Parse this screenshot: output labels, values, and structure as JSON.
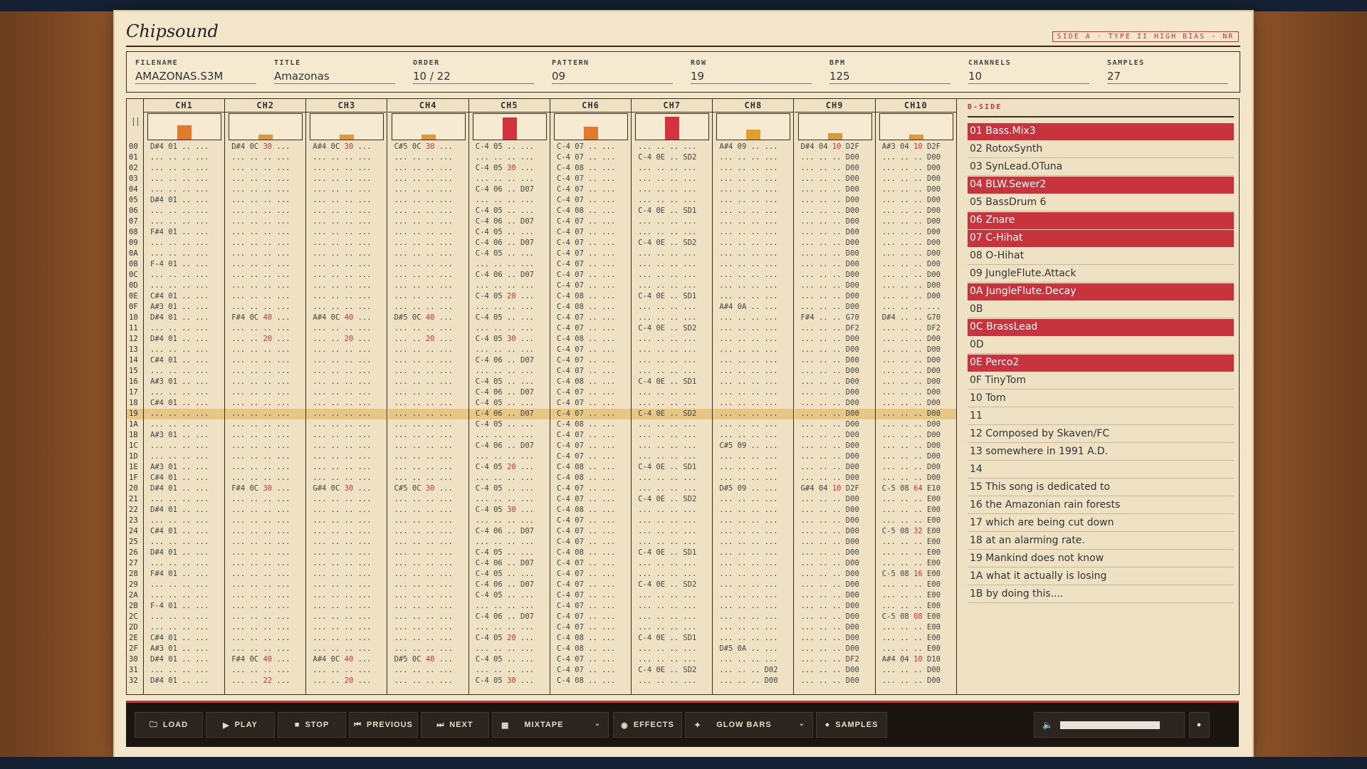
{
  "app": {
    "title": "Chipsound",
    "tape_label": "SIDE A · TYPE II HIGH BIAS · NR"
  },
  "meta": [
    {
      "label": "FILENAME",
      "value": "AMAZONAS.S3M"
    },
    {
      "label": "TITLE",
      "value": "Amazonas"
    },
    {
      "label": "ORDER",
      "value": "10 / 22"
    },
    {
      "label": "PATTERN",
      "value": "09"
    },
    {
      "label": "ROW",
      "value": "19"
    },
    {
      "label": "BPM",
      "value": "125"
    },
    {
      "label": "CHANNELS",
      "value": "10"
    },
    {
      "label": "SAMPLES",
      "value": "27"
    }
  ],
  "channels": [
    {
      "name": "CH1",
      "level": 0.55,
      "color": "#e07a2c"
    },
    {
      "name": "CH2",
      "level": 0.2,
      "color": "#d89a3c"
    },
    {
      "name": "CH3",
      "level": 0.2,
      "color": "#d89a3c"
    },
    {
      "name": "CH4",
      "level": 0.2,
      "color": "#d89a3c"
    },
    {
      "name": "CH5",
      "level": 0.85,
      "color": "#d2343f"
    },
    {
      "name": "CH6",
      "level": 0.5,
      "color": "#e07a2c"
    },
    {
      "name": "CH7",
      "level": 0.9,
      "color": "#d2343f"
    },
    {
      "name": "CH8",
      "level": 0.4,
      "color": "#e0a02c"
    },
    {
      "name": "CH9",
      "level": 0.25,
      "color": "#d89a3c"
    },
    {
      "name": "CH10",
      "level": 0.2,
      "color": "#d89a3c"
    }
  ],
  "current_row": "19",
  "rows": [
    "00",
    "01",
    "02",
    "03",
    "04",
    "05",
    "06",
    "07",
    "08",
    "09",
    "0A",
    "0B",
    "0C",
    "0D",
    "0E",
    "0F",
    "10",
    "11",
    "12",
    "13",
    "14",
    "15",
    "16",
    "17",
    "18",
    "19",
    "1A",
    "1B",
    "1C",
    "1D",
    "1E",
    "1F",
    "20",
    "21",
    "22",
    "23",
    "24",
    "25",
    "26",
    "27",
    "28",
    "29",
    "2A",
    "2B",
    "2C",
    "2D",
    "2E",
    "2F",
    "30",
    "31",
    "32"
  ],
  "pattern": [
    [
      "D#4 01 .. ...",
      "... .. .. ...",
      "... .. .. ...",
      "... .. .. ...",
      "... .. .. ...",
      "D#4 01 .. ...",
      "... .. .. ...",
      "... .. .. ...",
      "F#4 01 .. ...",
      "... .. .. ...",
      "... .. .. ...",
      "F-4 01 .. ...",
      "... .. .. ...",
      "... .. .. ...",
      "C#4 01 .. ...",
      "A#3 01 .. ...",
      "D#4 01 .. ...",
      "... .. .. ...",
      "D#4 01 .. ...",
      "... .. .. ...",
      "C#4 01 .. ...",
      "... .. .. ...",
      "A#3 01 .. ...",
      "... .. .. ...",
      "C#4 01 .. ...",
      "... .. .. ...",
      "... .. .. ...",
      "A#3 01 .. ...",
      "... .. .. ...",
      "... .. .. ...",
      "A#3 01 .. ...",
      "C#4 01 .. ...",
      "D#4 01 .. ...",
      "... .. .. ...",
      "D#4 01 .. ...",
      "... .. .. ...",
      "C#4 01 .. ...",
      "... .. .. ...",
      "D#4 01 .. ...",
      "... .. .. ...",
      "F#4 01 .. ...",
      "... .. .. ...",
      "... .. .. ...",
      "F-4 01 .. ...",
      "... .. .. ...",
      "... .. .. ...",
      "C#4 01 .. ...",
      "A#3 01 .. ...",
      "D#4 01 .. ...",
      "... .. .. ...",
      "D#4 01 .. ..."
    ],
    [
      "D#4 0C 30 ...",
      "... .. .. ...",
      "... .. .. ...",
      "... .. .. ...",
      "... .. .. ...",
      "... .. .. ...",
      "... .. .. ...",
      "... .. .. ...",
      "... .. .. ...",
      "... .. .. ...",
      "... .. .. ...",
      "... .. .. ...",
      "... .. .. ...",
      "... .. .. ...",
      "... .. .. ...",
      "... .. .. ...",
      "F#4 0C 40 ...",
      "... .. .. ...",
      "... .. 20 ...",
      "... .. .. ...",
      "... .. .. ...",
      "... .. .. ...",
      "... .. .. ...",
      "... .. .. ...",
      "... .. .. ...",
      "... .. .. ...",
      "... .. .. ...",
      "... .. .. ...",
      "... .. .. ...",
      "... .. .. ...",
      "... .. .. ...",
      "... .. .. ...",
      "F#4 0C 30 ...",
      "... .. .. ...",
      "... .. .. ...",
      "... .. .. ...",
      "... .. .. ...",
      "... .. .. ...",
      "... .. .. ...",
      "... .. .. ...",
      "... .. .. ...",
      "... .. .. ...",
      "... .. .. ...",
      "... .. .. ...",
      "... .. .. ...",
      "... .. .. ...",
      "... .. .. ...",
      "... .. .. ...",
      "F#4 0C 40 ...",
      "... .. .. ...",
      "... .. 22 ..."
    ],
    [
      "A#4 0C 30 ...",
      "... .. .. ...",
      "... .. .. ...",
      "... .. .. ...",
      "... .. .. ...",
      "... .. .. ...",
      "... .. .. ...",
      "... .. .. ...",
      "... .. .. ...",
      "... .. .. ...",
      "... .. .. ...",
      "... .. .. ...",
      "... .. .. ...",
      "... .. .. ...",
      "... .. .. ...",
      "... .. .. ...",
      "A#4 0C 40 ...",
      "... .. .. ...",
      "... .. 20 ...",
      "... .. .. ...",
      "... .. .. ...",
      "... .. .. ...",
      "... .. .. ...",
      "... .. .. ...",
      "... .. .. ...",
      "... .. .. ...",
      "... .. .. ...",
      "... .. .. ...",
      "... .. .. ...",
      "... .. .. ...",
      "... .. .. ...",
      "... .. .. ...",
      "G#4 0C 30 ...",
      "... .. .. ...",
      "... .. .. ...",
      "... .. .. ...",
      "... .. .. ...",
      "... .. .. ...",
      "... .. .. ...",
      "... .. .. ...",
      "... .. .. ...",
      "... .. .. ...",
      "... .. .. ...",
      "... .. .. ...",
      "... .. .. ...",
      "... .. .. ...",
      "... .. .. ...",
      "... .. .. ...",
      "A#4 0C 40 ...",
      "... .. .. ...",
      "... .. 20 ..."
    ],
    [
      "C#5 0C 30 ...",
      "... .. .. ...",
      "... .. .. ...",
      "... .. .. ...",
      "... .. .. ...",
      "... .. .. ...",
      "... .. .. ...",
      "... .. .. ...",
      "... .. .. ...",
      "... .. .. ...",
      "... .. .. ...",
      "... .. .. ...",
      "... .. .. ...",
      "... .. .. ...",
      "... .. .. ...",
      "... .. .. ...",
      "D#5 0C 40 ...",
      "... .. .. ...",
      "... .. 20 ...",
      "... .. .. ...",
      "... .. .. ...",
      "... .. .. ...",
      "... .. .. ...",
      "... .. .. ...",
      "... .. .. ...",
      "... .. .. ...",
      "... .. .. ...",
      "... .. .. ...",
      "... .. .. ...",
      "... .. .. ...",
      "... .. .. ...",
      "... .. .. ...",
      "C#5 0C 30 ...",
      "... .. .. ...",
      "... .. .. ...",
      "... .. .. ...",
      "... .. .. ...",
      "... .. .. ...",
      "... .. .. ...",
      "... .. .. ...",
      "... .. .. ...",
      "... .. .. ...",
      "... .. .. ...",
      "... .. .. ...",
      "... .. .. ...",
      "... .. .. ...",
      "... .. .. ...",
      "... .. .. ...",
      "D#5 0C 40 ...",
      "... .. .. ...",
      "... .. .. ..."
    ],
    [
      "C-4 05 .. ...",
      "... .. .. ...",
      "C-4 05 30 ...",
      "... .. .. ...",
      "C-4 06 .. D07",
      "... .. .. ...",
      "C-4 05 .. ...",
      "C-4 06 .. D07",
      "C-4 05 .. ...",
      "C-4 06 .. D07",
      "C-4 05 .. ...",
      "... .. .. ...",
      "C-4 06 .. D07",
      "... .. .. ...",
      "C-4 05 20 ...",
      "... .. .. ...",
      "C-4 05 .. ...",
      "... .. .. ...",
      "C-4 05 30 ...",
      "... .. .. ...",
      "C-4 06 .. D07",
      "... .. .. ...",
      "C-4 05 .. ...",
      "C-4 06 .. D07",
      "C-4 05 .. ...",
      "C-4 06 .. D07",
      "C-4 05 .. ...",
      "... .. .. ...",
      "C-4 06 .. D07",
      "... .. .. ...",
      "C-4 05 20 ...",
      "... .. .. ...",
      "C-4 05 .. ...",
      "... .. .. ...",
      "C-4 05 30 ...",
      "... .. .. ...",
      "C-4 06 .. D07",
      "... .. .. ...",
      "C-4 05 .. ...",
      "C-4 06 .. D07",
      "C-4 05 .. ...",
      "C-4 06 .. D07",
      "C-4 05 .. ...",
      "... .. .. ...",
      "C-4 06 .. D07",
      "... .. .. ...",
      "C-4 05 20 ...",
      "... .. .. ...",
      "C-4 05 .. ...",
      "... .. .. ...",
      "C-4 05 30 ..."
    ],
    [
      "C-4 07 .. ...",
      "C-4 07 .. ...",
      "C-4 08 .. ...",
      "C-4 07 .. ...",
      "C-4 07 .. ...",
      "C-4 07 .. ...",
      "C-4 08 .. ...",
      "C-4 07 .. ...",
      "C-4 07 .. ...",
      "C-4 07 .. ...",
      "C-4 07 .. ...",
      "C-4 07 .. ...",
      "C-4 07 .. ...",
      "C-4 07 .. ...",
      "C-4 08 .. ...",
      "C-4 08 .. ...",
      "C-4 07 .. ...",
      "C-4 07 .. ...",
      "C-4 08 .. ...",
      "C-4 07 .. ...",
      "C-4 07 .. ...",
      "C-4 07 .. ...",
      "C-4 08 .. ...",
      "C-4 07 .. ...",
      "C-4 07 .. ...",
      "C-4 07 .. ...",
      "C-4 08 .. ...",
      "C-4 07 .. ...",
      "C-4 07 .. ...",
      "C-4 07 .. ...",
      "C-4 08 .. ...",
      "C-4 08 .. ...",
      "C-4 07 .. ...",
      "C-4 07 .. ...",
      "C-4 08 .. ...",
      "C-4 07 .. ...",
      "C-4 07 .. ...",
      "C-4 07 .. ...",
      "C-4 08 .. ...",
      "C-4 07 .. ...",
      "C-4 07 .. ...",
      "C-4 07 .. ...",
      "C-4 07 .. ...",
      "C-4 07 .. ...",
      "C-4 07 .. ...",
      "C-4 07 .. ...",
      "C-4 08 .. ...",
      "C-4 08 .. ...",
      "C-4 07 .. ...",
      "C-4 07 .. ...",
      "C-4 08 .. ..."
    ],
    [
      "... .. .. ...",
      "C-4 0E .. SD2",
      "... .. .. ...",
      "... .. .. ...",
      "... .. .. ...",
      "... .. .. ...",
      "C-4 0E .. SD1",
      "... .. .. ...",
      "... .. .. ...",
      "C-4 0E .. SD2",
      "... .. .. ...",
      "... .. .. ...",
      "... .. .. ...",
      "... .. .. ...",
      "C-4 0E .. SD1",
      "... .. .. ...",
      "... .. .. ...",
      "C-4 0E .. SD2",
      "... .. .. ...",
      "... .. .. ...",
      "... .. .. ...",
      "... .. .. ...",
      "C-4 0E .. SD1",
      "... .. .. ...",
      "... .. .. ...",
      "C-4 0E .. SD2",
      "... .. .. ...",
      "... .. .. ...",
      "... .. .. ...",
      "... .. .. ...",
      "C-4 0E .. SD1",
      "... .. .. ...",
      "... .. .. ...",
      "C-4 0E .. SD2",
      "... .. .. ...",
      "... .. .. ...",
      "... .. .. ...",
      "... .. .. ...",
      "C-4 0E .. SD1",
      "... .. .. ...",
      "... .. .. ...",
      "C-4 0E .. SD2",
      "... .. .. ...",
      "... .. .. ...",
      "... .. .. ...",
      "... .. .. ...",
      "C-4 0E .. SD1",
      "... .. .. ...",
      "... .. .. ...",
      "C-4 0E .. SD2",
      "... .. .. ..."
    ],
    [
      "A#4 09 .. ...",
      "... .. .. ...",
      "... .. .. ...",
      "... .. .. ...",
      "... .. .. ...",
      "... .. .. ...",
      "... .. .. ...",
      "... .. .. ...",
      "... .. .. ...",
      "... .. .. ...",
      "... .. .. ...",
      "... .. .. ...",
      "... .. .. ...",
      "... .. .. ...",
      "... .. .. ...",
      "A#4 0A .. ...",
      "... .. .. ...",
      "... .. .. ...",
      "... .. .. ...",
      "... .. .. ...",
      "... .. .. ...",
      "... .. .. ...",
      "... .. .. ...",
      "... .. .. ...",
      "... .. .. ...",
      "... .. .. ...",
      "... .. .. ...",
      "... .. .. ...",
      "C#5 09 .. ...",
      "... .. .. ...",
      "... .. .. ...",
      "... .. .. ...",
      "D#5 09 .. ...",
      "... .. .. ...",
      "... .. .. ...",
      "... .. .. ...",
      "... .. .. ...",
      "... .. .. ...",
      "... .. .. ...",
      "... .. .. ...",
      "... .. .. ...",
      "... .. .. ...",
      "... .. .. ...",
      "... .. .. ...",
      "... .. .. ...",
      "... .. .. ...",
      "... .. .. ...",
      "D#5 0A .. ...",
      "... .. .. ...",
      "... .. .. D02",
      "... .. .. D00"
    ],
    [
      "D#4 04 10 D2F",
      "... .. .. D00",
      "... .. .. D00",
      "... .. .. D00",
      "... .. .. D00",
      "... .. .. D00",
      "... .. .. D00",
      "... .. .. D00",
      "... .. .. D00",
      "... .. .. D00",
      "... .. .. D00",
      "... .. .. D00",
      "... .. .. D00",
      "... .. .. D00",
      "... .. .. D00",
      "... .. .. D00",
      "F#4 .. .. G70",
      "... .. .. DF2",
      "... .. .. D00",
      "... .. .. D00",
      "... .. .. D00",
      "... .. .. D00",
      "... .. .. D00",
      "... .. .. D00",
      "... .. .. D00",
      "... .. .. D00",
      "... .. .. D00",
      "... .. .. D00",
      "... .. .. D00",
      "... .. .. D00",
      "... .. .. D00",
      "... .. .. D00",
      "G#4 04 10 D2F",
      "... .. .. D00",
      "... .. .. D00",
      "... .. .. D00",
      "... .. .. D00",
      "... .. .. D00",
      "... .. .. D00",
      "... .. .. D00",
      "... .. .. D00",
      "... .. .. D00",
      "... .. .. D00",
      "... .. .. D00",
      "... .. .. D00",
      "... .. .. D00",
      "... .. .. D00",
      "... .. .. D00",
      "... .. .. DF2",
      "... .. .. D00",
      "... .. .. D00"
    ],
    [
      "A#3 04 10 D2F",
      "... .. .. D00",
      "... .. .. D00",
      "... .. .. D00",
      "... .. .. D00",
      "... .. .. D00",
      "... .. .. D00",
      "... .. .. D00",
      "... .. .. D00",
      "... .. .. D00",
      "... .. .. D00",
      "... .. .. D00",
      "... .. .. D00",
      "... .. .. D00",
      "... .. .. D00",
      "... .. .. ...",
      "D#4 .. .. G70",
      "... .. .. DF2",
      "... .. .. D00",
      "... .. .. D00",
      "... .. .. D00",
      "... .. .. D00",
      "... .. .. D00",
      "... .. .. D00",
      "... .. .. D00",
      "... .. .. D00",
      "... .. .. D00",
      "... .. .. D00",
      "... .. .. D00",
      "... .. .. D00",
      "... .. .. D00",
      "... .. .. D00",
      "C-5 08 64 E10",
      "... .. .. E00",
      "... .. .. E00",
      "... .. .. E00",
      "C-5 08 32 E00",
      "... .. .. E00",
      "... .. .. E00",
      "... .. .. E00",
      "C-5 08 16 E00",
      "... .. .. E00",
      "... .. .. E00",
      "... .. .. E00",
      "C-5 08 08 E00",
      "... .. .. E00",
      "... .. .. E00",
      "... .. .. E00",
      "A#4 04 10 D10",
      "... .. .. D00",
      "... .. .. D00"
    ]
  ],
  "samples_panel": {
    "header": "B-SIDE",
    "items": [
      {
        "text": "01 Bass.Mix3",
        "hl": true
      },
      {
        "text": "02 RotoxSynth",
        "hl": false
      },
      {
        "text": "03 SynLead.OTuna",
        "hl": false
      },
      {
        "text": "04 BLW.Sewer2",
        "hl": true
      },
      {
        "text": "05 BassDrum 6",
        "hl": false
      },
      {
        "text": "06 Znare",
        "hl": true
      },
      {
        "text": "07 C-Hihat",
        "hl": true
      },
      {
        "text": "08 O-Hihat",
        "hl": false
      },
      {
        "text": "09 JungleFlute.Attack",
        "hl": false
      },
      {
        "text": "0A JungleFlute.Decay",
        "hl": true
      },
      {
        "text": "0B",
        "hl": false
      },
      {
        "text": "0C BrassLead",
        "hl": true
      },
      {
        "text": "0D",
        "hl": false
      },
      {
        "text": "0E Perco2",
        "hl": true
      },
      {
        "text": "0F TinyTom",
        "hl": false
      },
      {
        "text": "10 Tom",
        "hl": false
      },
      {
        "text": "11",
        "hl": false
      },
      {
        "text": "12   Composed by Skaven/FC",
        "hl": false
      },
      {
        "text": "13   somewhere in 1991 A.D.",
        "hl": false
      },
      {
        "text": "14",
        "hl": false
      },
      {
        "text": "15   This song is dedicated to",
        "hl": false
      },
      {
        "text": "16   the Amazonian rain forests",
        "hl": false
      },
      {
        "text": "17   which are being cut down",
        "hl": false
      },
      {
        "text": "18   at an alarming rate.",
        "hl": false
      },
      {
        "text": "19   Mankind does not know",
        "hl": false
      },
      {
        "text": "1A   what it actually is losing",
        "hl": false
      },
      {
        "text": "1B   by doing this....",
        "hl": false
      }
    ]
  },
  "toolbar": {
    "load": "LOAD",
    "play": "PLAY",
    "stop": "STOP",
    "previous": "PREVIOUS",
    "next": "NEXT",
    "mixtape": "MIXTAPE",
    "effects": "EFFECTS",
    "glow_bars": "GLOW BARS",
    "samples": "SAMPLES"
  },
  "icons": {
    "load": "folder-icon",
    "play": "play-icon",
    "stop": "stop-icon",
    "previous": "skip-back-icon",
    "next": "skip-forward-icon",
    "mixtape": "grid-icon",
    "effects": "eye-icon",
    "glow_bars": "wand-icon",
    "samples": "disc-icon",
    "volume": "speaker-icon",
    "help": "info-icon",
    "menu": "chevron-down-icon"
  },
  "volume_level": 1.0,
  "colors": {
    "accent": "#c8343d",
    "highlight_row": "#e6c784",
    "paper": "#f3e6cb",
    "ink": "#3a2a1a",
    "toolbar": "#1b1512"
  }
}
